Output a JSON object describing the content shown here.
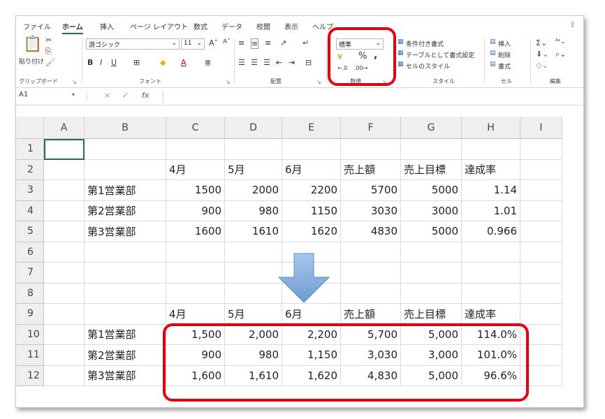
{
  "ribbon": {
    "tabs": [
      "ファイル",
      "ホーム",
      "挿入",
      "ページ レイアウト",
      "数式",
      "データ",
      "校閲",
      "表示",
      "ヘルプ"
    ],
    "clipboard": {
      "paste_label": "貼り付け",
      "group_label": "クリップボード"
    },
    "font": {
      "font_name": "游ゴシック",
      "font_size": "11",
      "bold": "B",
      "italic": "I",
      "underline": "U",
      "group_label": "フォント"
    },
    "alignment": {
      "group_label": "配置"
    },
    "number": {
      "format_value": "標準",
      "percent": "%",
      "comma": ",",
      "group_label": "数値"
    },
    "styles": {
      "conditional": "条件付き書式",
      "table_format": "テーブルとして書式設定",
      "cell_styles": "セルのスタイル",
      "group_label": "スタイル"
    },
    "cells": {
      "insert": "挿入",
      "delete": "削除",
      "format": "書式",
      "group_label": "セル"
    },
    "editing": {
      "group_label": "編集"
    }
  },
  "formula_bar": {
    "name_box": "A1",
    "fx": "fx",
    "cancel": "×",
    "enter": "✓",
    "value": ""
  },
  "columns": [
    "A",
    "B",
    "C",
    "D",
    "E",
    "F",
    "G",
    "H",
    "I"
  ],
  "rows": [
    "1",
    "2",
    "3",
    "4",
    "5",
    "6",
    "7",
    "8",
    "9",
    "10",
    "11",
    "12"
  ],
  "table_before": {
    "headers": [
      "4月",
      "5月",
      "6月",
      "売上額",
      "売上目標",
      "達成率"
    ],
    "rows": [
      [
        "第1営業部",
        "1500",
        "2000",
        "2200",
        "5700",
        "5000",
        "1.14"
      ],
      [
        "第2営業部",
        "900",
        "980",
        "1150",
        "3030",
        "3000",
        "1.01"
      ],
      [
        "第3営業部",
        "1600",
        "1610",
        "1620",
        "4830",
        "5000",
        "0.966"
      ]
    ]
  },
  "table_after": {
    "headers": [
      "4月",
      "5月",
      "6月",
      "売上額",
      "売上目標",
      "達成率"
    ],
    "rows": [
      [
        "第1営業部",
        "1,500",
        "2,000",
        "2,200",
        "5,700",
        "5,000",
        "114.0%"
      ],
      [
        "第2営業部",
        "900",
        "980",
        "1,150",
        "3,030",
        "3,000",
        "101.0%"
      ],
      [
        "第3営業部",
        "1,600",
        "1,610",
        "1,620",
        "4,830",
        "5,000",
        "96.6%"
      ]
    ]
  },
  "colors": {
    "highlight": "#e60012",
    "arrow_top": "#a9c6ea",
    "arrow_bottom": "#6d9bd3",
    "selection": "#217346"
  },
  "icons": [
    "paste-icon",
    "cut-icon",
    "copy-icon",
    "format-painter-icon",
    "border-icon",
    "fill-color-icon",
    "font-color-icon",
    "percent-icon",
    "comma-icon",
    "increase-decimal-icon",
    "decrease-decimal-icon",
    "sum-icon",
    "sort-filter-icon",
    "find-icon",
    "down-arrow-icon"
  ]
}
